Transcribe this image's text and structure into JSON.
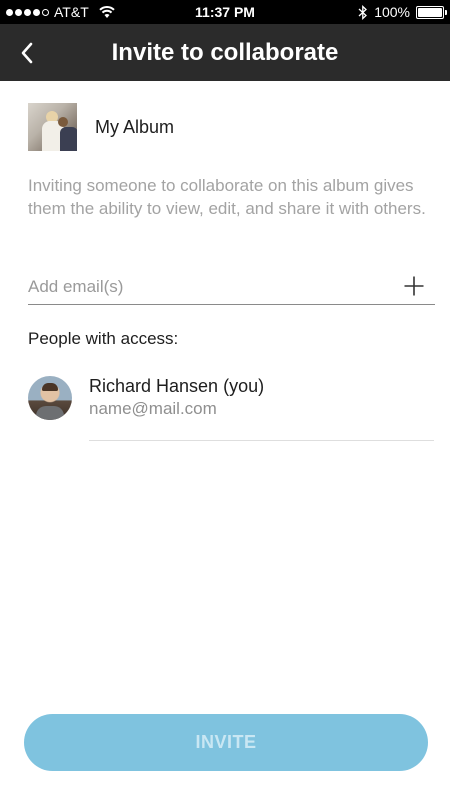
{
  "status_bar": {
    "carrier": "AT&T",
    "time": "11:37 PM",
    "battery": "100%",
    "icons": [
      "signal-dots-icon",
      "wifi-icon",
      "bluetooth-icon",
      "battery-icon"
    ]
  },
  "nav": {
    "title": "Invite to collaborate",
    "back_icon": "chevron-left-icon"
  },
  "album": {
    "name": "My Album"
  },
  "description": "Inviting someone to collaborate on this album gives them the ability to view, edit, and share it with others.",
  "email_field": {
    "placeholder": "Add email(s)",
    "value": "",
    "add_icon": "plus-icon"
  },
  "access": {
    "header": "People with access:",
    "people": [
      {
        "name": "Richard Hansen (you)",
        "email": "name@mail.com"
      }
    ]
  },
  "invite_button": {
    "label": "INVITE"
  },
  "colors": {
    "nav_background": "#2b2b2b",
    "invite_button": "#7fc3df",
    "invite_button_text": "#c9e7f3",
    "secondary_text": "#a3a3a3"
  }
}
